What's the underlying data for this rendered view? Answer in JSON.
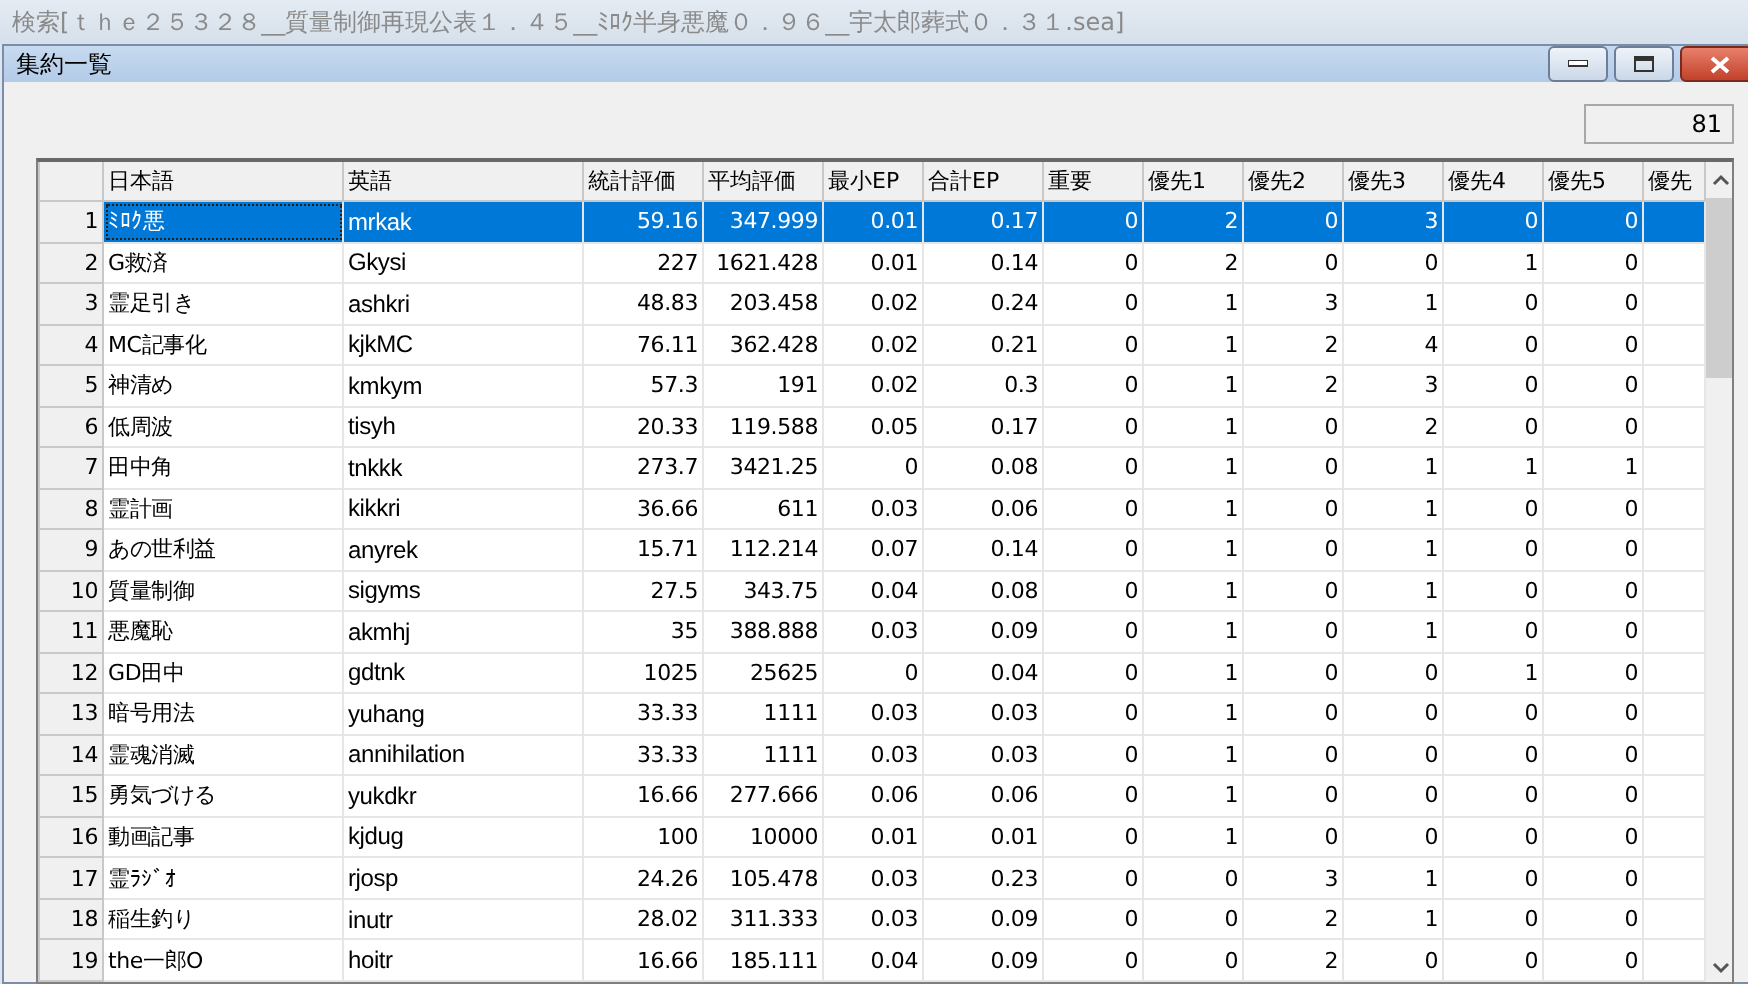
{
  "outer_window": {
    "title": "検索[ｔｈｅ２５３２８__質量制御再現公表１．４５__ﾐﾛｸ半身悪魔０．９６__宇太郎葬式０．３１.sea]"
  },
  "window": {
    "title": "集約一覧"
  },
  "count": "81",
  "table": {
    "columns": [
      "日本語",
      "英語",
      "統計評価",
      "平均評価",
      "最小EP",
      "合計EP",
      "重要",
      "優先1",
      "優先2",
      "優先3",
      "優先4",
      "優先5",
      "優先"
    ],
    "rows": [
      {
        "number": "1",
        "selected": true,
        "cells": [
          "ﾐﾛｸ悪",
          "mrkak",
          "59.16",
          "347.999",
          "0.01",
          "0.17",
          "0",
          "2",
          "0",
          "3",
          "0",
          "0"
        ]
      },
      {
        "number": "2",
        "selected": false,
        "cells": [
          "G救済",
          "Gkysi",
          "227",
          "1621.428",
          "0.01",
          "0.14",
          "0",
          "2",
          "0",
          "0",
          "1",
          "0"
        ]
      },
      {
        "number": "3",
        "selected": false,
        "cells": [
          "霊足引き",
          "ashkri",
          "48.83",
          "203.458",
          "0.02",
          "0.24",
          "0",
          "1",
          "3",
          "1",
          "0",
          "0"
        ]
      },
      {
        "number": "4",
        "selected": false,
        "cells": [
          "MC記事化",
          "kjkMC",
          "76.11",
          "362.428",
          "0.02",
          "0.21",
          "0",
          "1",
          "2",
          "4",
          "0",
          "0"
        ]
      },
      {
        "number": "5",
        "selected": false,
        "cells": [
          "神清め",
          "kmkym",
          "57.3",
          "191",
          "0.02",
          "0.3",
          "0",
          "1",
          "2",
          "3",
          "0",
          "0"
        ]
      },
      {
        "number": "6",
        "selected": false,
        "cells": [
          "低周波",
          "tisyh",
          "20.33",
          "119.588",
          "0.05",
          "0.17",
          "0",
          "1",
          "0",
          "2",
          "0",
          "0"
        ]
      },
      {
        "number": "7",
        "selected": false,
        "cells": [
          "田中角",
          "tnkkk",
          "273.7",
          "3421.25",
          "0",
          "0.08",
          "0",
          "1",
          "0",
          "1",
          "1",
          "1"
        ]
      },
      {
        "number": "8",
        "selected": false,
        "cells": [
          "霊計画",
          "kikkri",
          "36.66",
          "611",
          "0.03",
          "0.06",
          "0",
          "1",
          "0",
          "1",
          "0",
          "0"
        ]
      },
      {
        "number": "9",
        "selected": false,
        "cells": [
          "あの世利益",
          "anyrek",
          "15.71",
          "112.214",
          "0.07",
          "0.14",
          "0",
          "1",
          "0",
          "1",
          "0",
          "0"
        ]
      },
      {
        "number": "10",
        "selected": false,
        "cells": [
          "質量制御",
          "sigyms",
          "27.5",
          "343.75",
          "0.04",
          "0.08",
          "0",
          "1",
          "0",
          "1",
          "0",
          "0"
        ]
      },
      {
        "number": "11",
        "selected": false,
        "cells": [
          "悪魔恥",
          "akmhj",
          "35",
          "388.888",
          "0.03",
          "0.09",
          "0",
          "1",
          "0",
          "1",
          "0",
          "0"
        ]
      },
      {
        "number": "12",
        "selected": false,
        "cells": [
          "GD田中",
          "gdtnk",
          "1025",
          "25625",
          "0",
          "0.04",
          "0",
          "1",
          "0",
          "0",
          "1",
          "0"
        ]
      },
      {
        "number": "13",
        "selected": false,
        "cells": [
          "暗号用法",
          "yuhang",
          "33.33",
          "1111",
          "0.03",
          "0.03",
          "0",
          "1",
          "0",
          "0",
          "0",
          "0"
        ]
      },
      {
        "number": "14",
        "selected": false,
        "cells": [
          "霊魂消滅",
          "annihilation",
          "33.33",
          "1111",
          "0.03",
          "0.03",
          "0",
          "1",
          "0",
          "0",
          "0",
          "0"
        ]
      },
      {
        "number": "15",
        "selected": false,
        "cells": [
          "勇気づける",
          "yukdkr",
          "16.66",
          "277.666",
          "0.06",
          "0.06",
          "0",
          "1",
          "0",
          "0",
          "0",
          "0"
        ]
      },
      {
        "number": "16",
        "selected": false,
        "cells": [
          "動画記事",
          "kjdug",
          "100",
          "10000",
          "0.01",
          "0.01",
          "0",
          "1",
          "0",
          "0",
          "0",
          "0"
        ]
      },
      {
        "number": "17",
        "selected": false,
        "cells": [
          "霊ﾗｼﾞｵ",
          "rjosp",
          "24.26",
          "105.478",
          "0.03",
          "0.23",
          "0",
          "0",
          "3",
          "1",
          "0",
          "0"
        ]
      },
      {
        "number": "18",
        "selected": false,
        "cells": [
          "稲生釣り",
          "inutr",
          "28.02",
          "311.333",
          "0.03",
          "0.09",
          "0",
          "0",
          "2",
          "1",
          "0",
          "0"
        ]
      },
      {
        "number": "19",
        "selected": false,
        "cells": [
          "the一郎O",
          "hoitr",
          "16.66",
          "185.111",
          "0.04",
          "0.09",
          "0",
          "0",
          "2",
          "0",
          "0",
          "0"
        ]
      }
    ]
  }
}
